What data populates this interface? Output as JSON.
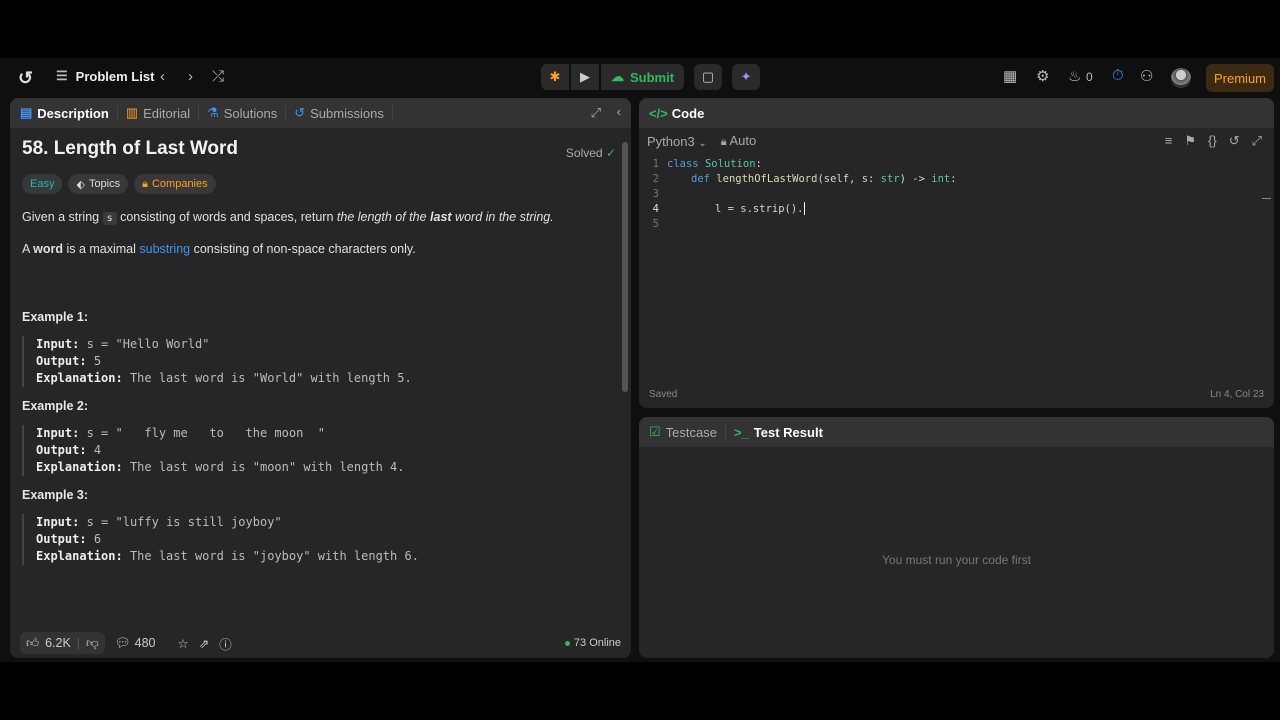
{
  "topbar": {
    "problem_list": "Problem List",
    "submit_label": "Submit",
    "streak_count": "0",
    "premium": "Premium"
  },
  "desc_panel": {
    "tabs": [
      {
        "label": "Description"
      },
      {
        "label": "Editorial"
      },
      {
        "label": "Solutions"
      },
      {
        "label": "Submissions"
      }
    ],
    "title": "58. Length of Last Word",
    "solved": "Solved",
    "tags": [
      "Easy",
      "Topics",
      "Companies"
    ],
    "p1": {
      "a": "Given a string ",
      "code": "s",
      "b": " consisting of words and spaces, return ",
      "c": "the length of the ",
      "d": "last",
      "e": " word in the string."
    },
    "p2": {
      "a": "A ",
      "b": "word",
      "c": " is a maximal ",
      "link": "substring",
      "d": " consisting of non-space characters only."
    },
    "examples": [
      {
        "heading": "Example 1:",
        "input": "s = \"Hello World\"",
        "output": "5",
        "explanation": "The last word is \"World\" with length 5."
      },
      {
        "heading": "Example 2:",
        "input": "s = \"   fly me   to   the moon  \"",
        "output": "4",
        "explanation": "The last word is \"moon\" with length 4."
      },
      {
        "heading": "Example 3:",
        "input": "s = \"luffy is still joyboy\"",
        "output": "6",
        "explanation": "The last word is \"joyboy\" with length 6."
      }
    ],
    "labels": {
      "input": "Input:",
      "output": "Output:",
      "explanation": "Explanation:"
    },
    "likes": "6.2K",
    "comments": "480",
    "online": "73 Online"
  },
  "code_panel": {
    "title": "Code",
    "language": "Python3",
    "auto": "Auto",
    "lines": [
      {
        "n": "1"
      },
      {
        "n": "2"
      },
      {
        "n": "3"
      },
      {
        "n": "4"
      },
      {
        "n": "5"
      }
    ],
    "status": "Saved",
    "position": "Ln 4, Col 23"
  },
  "result_panel": {
    "tabs": [
      "Testcase",
      "Test Result"
    ],
    "message": "You must run your code first"
  },
  "colors": {
    "accent_green": "#2cbb5d",
    "premium": "#ffa116",
    "easy": "#1cbaba",
    "link": "#3c96f5"
  }
}
